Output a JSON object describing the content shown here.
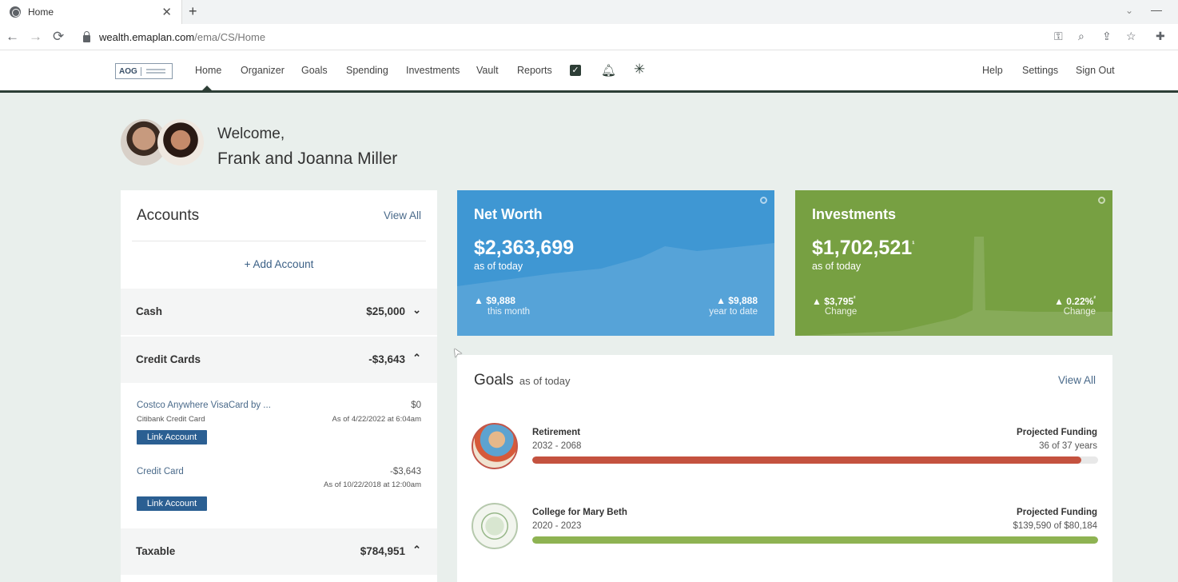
{
  "browser": {
    "tab_title": "Home",
    "close_glyph": "✕",
    "new_tab_glyph": "+",
    "url_host": "wealth.emaplan.com",
    "url_path": "/ema/CS/Home",
    "back_glyph": "←",
    "forward_glyph": "→",
    "reload_glyph": "⟳",
    "icons": [
      "key-icon",
      "zoom-icon",
      "share-icon",
      "star-icon",
      "extensions-icon"
    ]
  },
  "app": {
    "logo_text": "AOG",
    "nav": [
      "Home",
      "Organizer",
      "Goals",
      "Spending",
      "Investments",
      "Vault",
      "Reports"
    ],
    "nav_right": [
      "Help",
      "Settings",
      "Sign Out"
    ],
    "check_glyph": "✓",
    "bell_glyph": "🔔",
    "sparkle_glyph": "✳"
  },
  "welcome": {
    "line1": "Welcome,",
    "line2": "Frank and Joanna Miller"
  },
  "accounts": {
    "title": "Accounts",
    "view_all": "View All",
    "add_account": "+ Add Account",
    "sections": [
      {
        "label": "Cash",
        "amount": "$25,000",
        "chevron": "⌄"
      },
      {
        "label": "Credit Cards",
        "amount": "-$3,643",
        "chevron": "⌃"
      },
      {
        "label": "Taxable",
        "amount": "$784,951",
        "chevron": "⌃"
      }
    ],
    "items": [
      {
        "name": "Costco Anywhere VisaCard by ...",
        "sub": "Citibank Credit Card",
        "value": "$0",
        "as_of": "As of 4/22/2022 at 6:04am",
        "button": "Link Account"
      },
      {
        "name": "Credit Card",
        "sub": "",
        "value": "-$3,643",
        "as_of": "As of 10/22/2018 at 12:00am",
        "button": "Link Account"
      }
    ]
  },
  "net_worth": {
    "title": "Net Worth",
    "value": "$2,363,699",
    "as_of": "as of today",
    "left_stat": "$9,888",
    "left_label": "this month",
    "right_stat": "$9,888",
    "right_label": "year to date",
    "color": "#3f97d3"
  },
  "investments": {
    "title": "Investments",
    "value": "$1,702,521",
    "value_suffix": "¹",
    "as_of": "as of today",
    "left_stat": "$3,795",
    "left_suffix": "²",
    "left_label": "Change",
    "right_stat": "0.22%",
    "right_suffix": "²",
    "right_label": "Change",
    "color": "#77a042"
  },
  "goals": {
    "title": "Goals",
    "subtitle": "as of today",
    "view_all": "View All",
    "items": [
      {
        "name": "Retirement",
        "years": "2032 - 2068",
        "pf_label": "Projected Funding",
        "pf_value": "36 of 37 years",
        "progress": 0.97,
        "color": "#c4523f"
      },
      {
        "name": "College for Mary Beth",
        "years": "2020 - 2023",
        "pf_label": "Projected Funding",
        "pf_value": "$139,590 of $80,184",
        "progress": 1.0,
        "color": "#8eb352"
      }
    ]
  },
  "up_arrow": "🡅"
}
